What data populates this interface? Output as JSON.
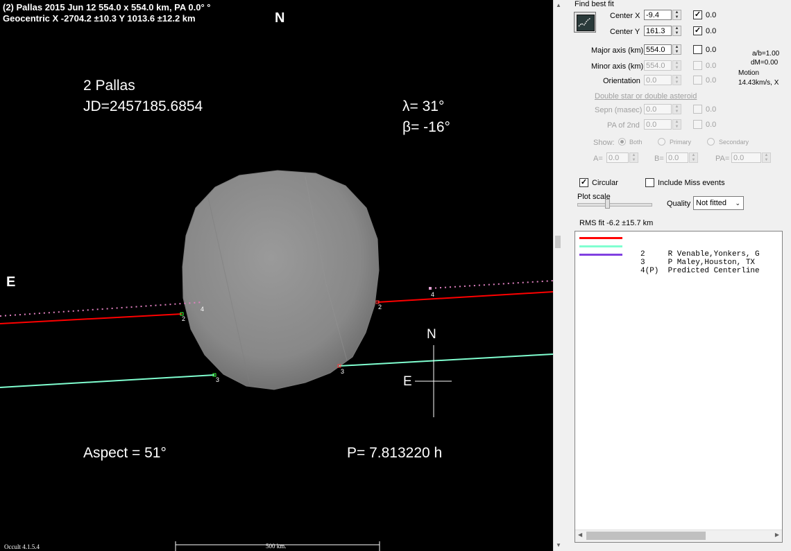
{
  "plot": {
    "header_line1": "(2) Pallas  2015 Jun 12  554.0 x 554.0 km, PA 0.0° °",
    "header_line2": "Geocentric  X  -2704.2 ±10.3  Y 1013.6 ±12.2 km",
    "north_label": "N",
    "east_label": "E",
    "object_name": "2 Pallas",
    "jd": "JD=2457185.6854",
    "lambda": "λ=  31°",
    "beta": "β= -16°",
    "aspect": "Aspect = 51°",
    "period": "P= 7.813220 h",
    "compass_n": "N",
    "compass_e": "E",
    "chord_labels": [
      "2",
      "2",
      "3",
      "3",
      "4",
      "4"
    ],
    "footer_version": "Occult 4.1.5.4",
    "footer_scale": "500 km.",
    "colors": {
      "chord2": "#ff0000",
      "chord3": "#80ffd0",
      "chord4": "#e080c0",
      "body": "#8a8a8a",
      "background": "#000000"
    }
  },
  "panel": {
    "find_best_fit": "Find best fit",
    "center_x_label": "Center X",
    "center_x_value": "-9.4",
    "center_x_fit": "0.0",
    "center_y_label": "Center Y",
    "center_y_value": "161.3",
    "center_y_fit": "0.0",
    "major_axis_label": "Major axis (km)",
    "major_axis_value": "554.0",
    "major_axis_fit": "0.0",
    "minor_axis_label": "Minor axis (km)",
    "minor_axis_value": "554.0",
    "minor_axis_fit": "0.0",
    "orientation_label": "Orientation",
    "orientation_value": "0.0",
    "orientation_fit": "0.0",
    "ab_ratio": "a/b=1.00",
    "dm": "dM=0.00",
    "motion_label": "Motion",
    "motion_value": "14.43km/s, X",
    "double_star_link": "Double star  or  double asteroid",
    "sepn_label": "Sepn (masec)",
    "sepn_value": "0.0",
    "sepn_fit": "0.0",
    "pa2nd_label": "PA of 2nd",
    "pa2nd_value": "0.0",
    "pa2nd_fit": "0.0",
    "show_label": "Show:",
    "show_both": "Both",
    "show_primary": "Primary",
    "show_secondary": "Secondary",
    "a_label": "A=",
    "a_value": "0.0",
    "b_label": "B=",
    "b_value": "0.0",
    "pa_label": "PA=",
    "pa_value": "0.0",
    "circular_label": "Circular",
    "include_miss_label": "Include Miss events",
    "plot_scale_label": "Plot scale",
    "quality_label": "Quality",
    "quality_value": "Not fitted",
    "rms_fit": "RMS fit  -6.2 ±15.7 km",
    "chords": [
      {
        "text": "2     R Venable,Yonkers, G",
        "color": "#ff0000"
      },
      {
        "text": "3     P Maley,Houston, TX",
        "color": "#80ffd0"
      },
      {
        "text": "4(P)  Predicted Centerline",
        "color": "#8040e0"
      }
    ]
  }
}
